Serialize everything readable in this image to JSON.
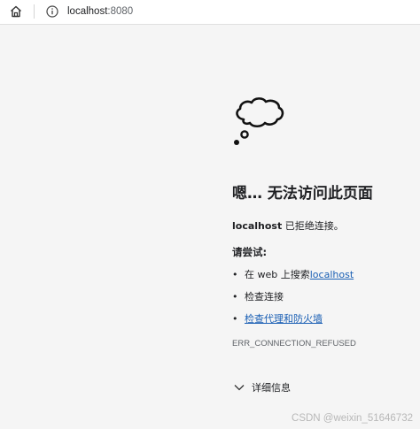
{
  "address_bar": {
    "host": "localhost",
    "port": ":8080"
  },
  "error_page": {
    "title": "嗯… 无法访问此页面",
    "message_host": "localhost",
    "message_text": " 已拒绝连接。",
    "try_heading": "请尝试:",
    "suggestions": {
      "s1_prefix": "在 web 上搜索 ",
      "s1_link": "localhost",
      "s2": "检查连接",
      "s3_link": "检查代理和防火墙"
    },
    "error_code": "ERR_CONNECTION_REFUSED",
    "details_label": "详细信息"
  },
  "watermark": "CSDN @weixin_51646732",
  "icons": [
    "home-icon",
    "info-icon",
    "thought-cloud-icon",
    "chevron-down-icon"
  ]
}
